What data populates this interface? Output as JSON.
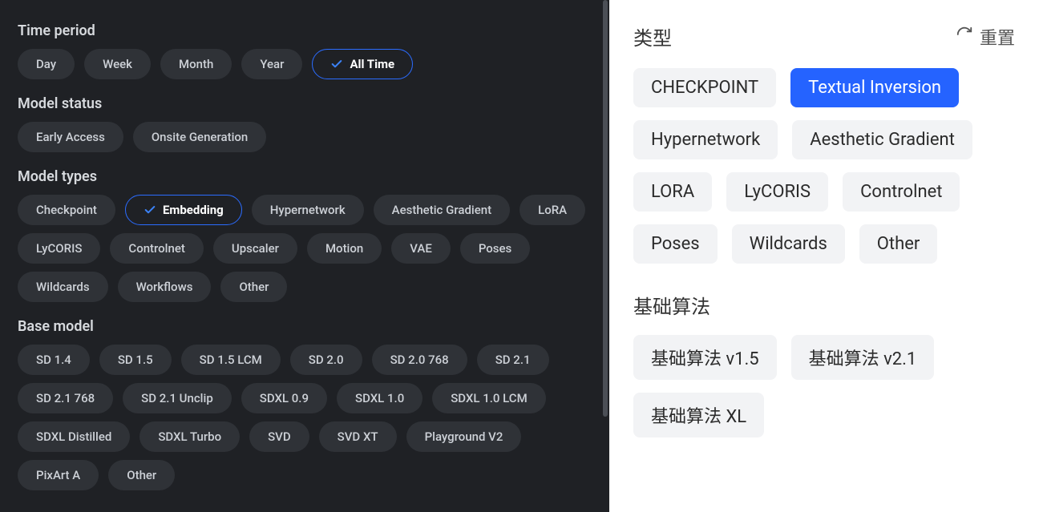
{
  "left": {
    "sections": {
      "time_period": {
        "heading": "Time period",
        "options": [
          "Day",
          "Week",
          "Month",
          "Year",
          "All Time"
        ],
        "selected": "All Time"
      },
      "model_status": {
        "heading": "Model status",
        "options": [
          "Early Access",
          "Onsite Generation"
        ],
        "selected": null
      },
      "model_types": {
        "heading": "Model types",
        "options": [
          "Checkpoint",
          "Embedding",
          "Hypernetwork",
          "Aesthetic Gradient",
          "LoRA",
          "LyCORIS",
          "Controlnet",
          "Upscaler",
          "Motion",
          "VAE",
          "Poses",
          "Wildcards",
          "Workflows",
          "Other"
        ],
        "selected": "Embedding"
      },
      "base_model": {
        "heading": "Base model",
        "options": [
          "SD 1.4",
          "SD 1.5",
          "SD 1.5 LCM",
          "SD 2.0",
          "SD 2.0 768",
          "SD 2.1",
          "SD 2.1 768",
          "SD 2.1 Unclip",
          "SDXL 0.9",
          "SDXL 1.0",
          "SDXL 1.0 LCM",
          "SDXL Distilled",
          "SDXL Turbo",
          "SVD",
          "SVD XT",
          "Playground V2",
          "PixArt A",
          "Other"
        ],
        "selected": null
      }
    }
  },
  "right": {
    "header": {
      "title": "类型",
      "reset": "重置"
    },
    "type_tags": {
      "options": [
        "CHECKPOINT",
        "Textual Inversion",
        "Hypernetwork",
        "Aesthetic Gradient",
        "LORA",
        "LyCORIS",
        "Controlnet",
        "Poses",
        "Wildcards",
        "Other"
      ],
      "selected": "Textual Inversion"
    },
    "base_algo": {
      "heading": "基础算法",
      "options": [
        "基础算法 v1.5",
        "基础算法 v2.1",
        "基础算法 XL"
      ],
      "selected": null
    }
  }
}
